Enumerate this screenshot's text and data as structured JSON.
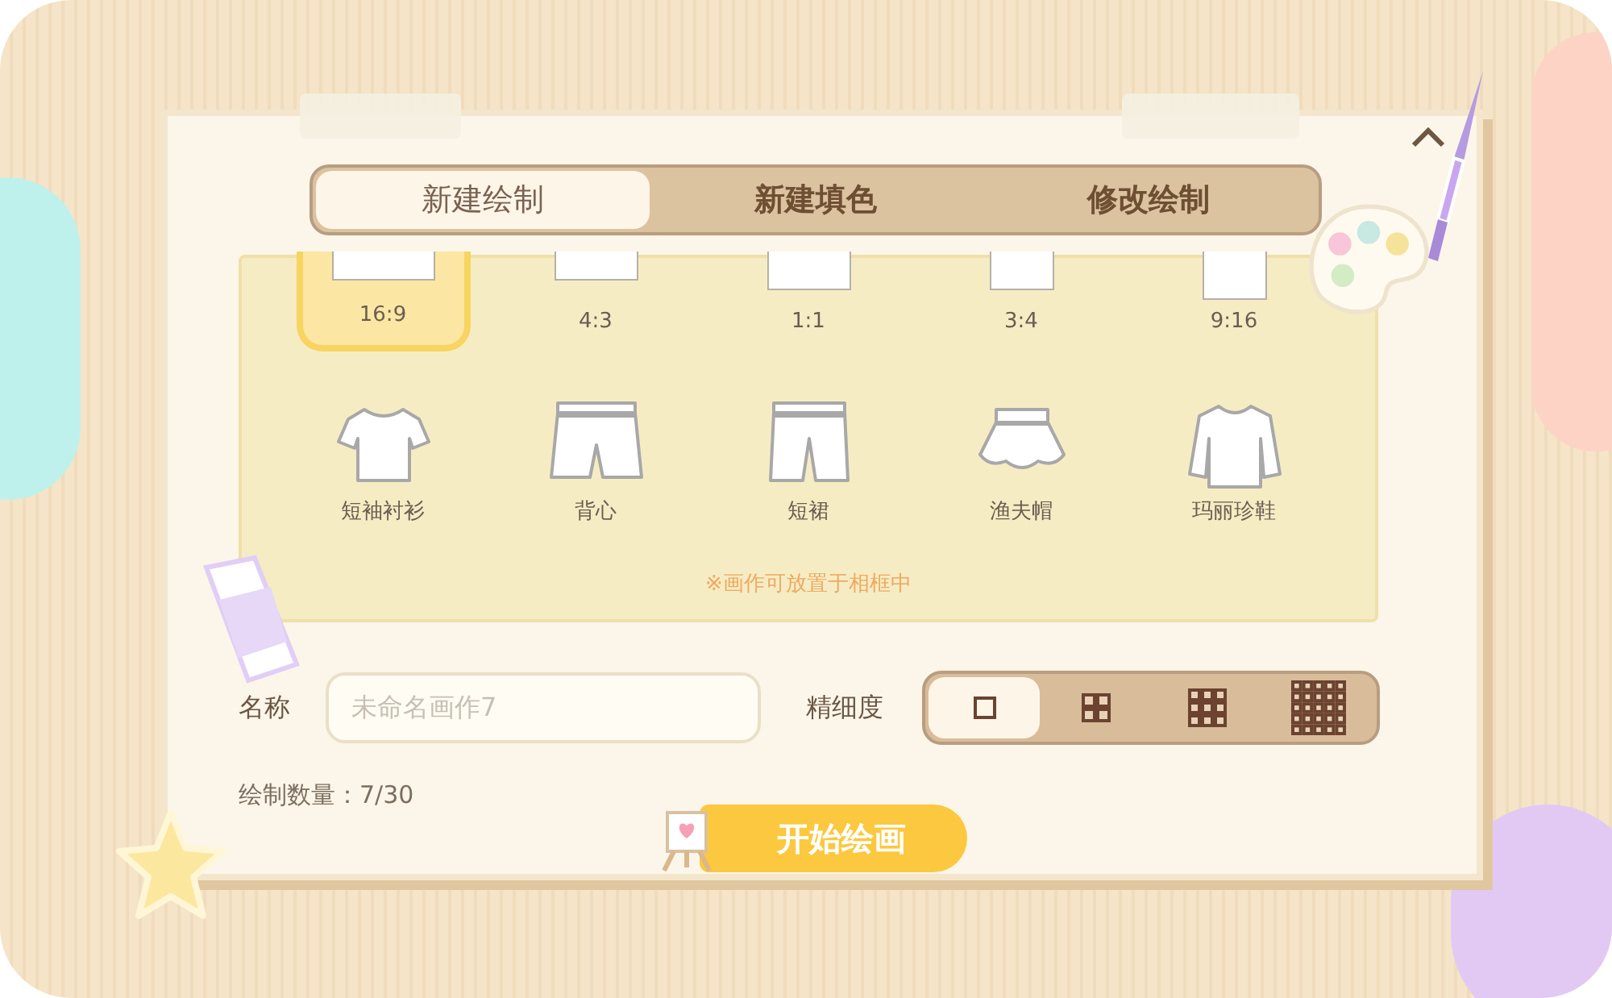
{
  "tabs": [
    {
      "label": "新建绘制",
      "selected": true
    },
    {
      "label": "新建填色",
      "selected": false
    },
    {
      "label": "修改绘制",
      "selected": false
    }
  ],
  "ratios": [
    {
      "label": "16:9",
      "selected": true
    },
    {
      "label": "4:3",
      "selected": false
    },
    {
      "label": "1:1",
      "selected": false
    },
    {
      "label": "3:4",
      "selected": false
    },
    {
      "label": "9:16",
      "selected": false
    }
  ],
  "templates": [
    {
      "label": "短袖衬衫",
      "kind": "tshirt"
    },
    {
      "label": "背心",
      "kind": "shorts"
    },
    {
      "label": "短裙",
      "kind": "pants"
    },
    {
      "label": "渔夫帽",
      "kind": "skirt"
    },
    {
      "label": "玛丽珍鞋",
      "kind": "blouse"
    }
  ],
  "note": "※画作可放置于相框中",
  "name_field": {
    "label": "名称",
    "placeholder": "未命名画作7"
  },
  "detail": {
    "label": "精细度",
    "levels": [
      {
        "selected": true
      },
      {
        "selected": false
      },
      {
        "selected": false
      },
      {
        "selected": false
      }
    ]
  },
  "count": "绘制数量：7/30",
  "start_button": "开始绘画"
}
